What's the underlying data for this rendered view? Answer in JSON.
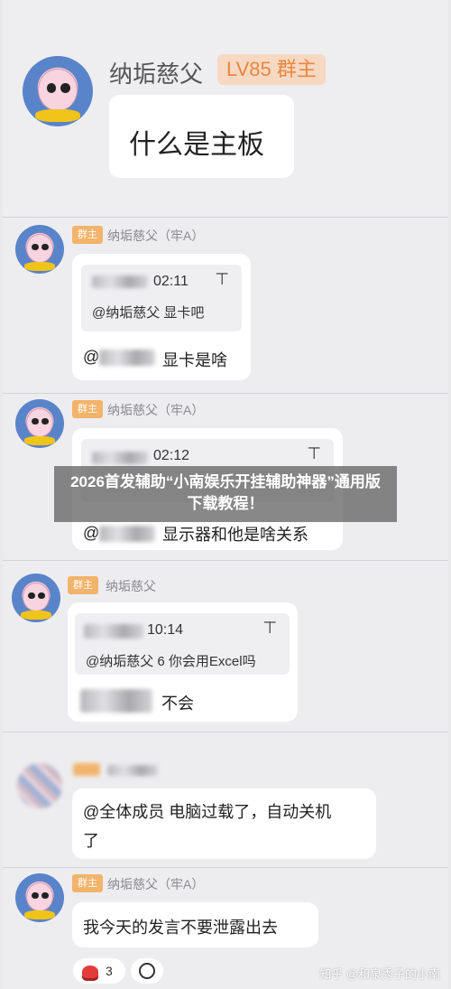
{
  "messages": [
    {
      "sender": "纳垢慈父",
      "badge": "LV85 群主",
      "text": "什么是主板"
    },
    {
      "sender": "纳垢慈父（牢A）",
      "badge": "群主",
      "quote_time": "02:11",
      "quote_text": "@纳垢慈父 显卡吧",
      "text": "显卡是啥"
    },
    {
      "sender": "纳垢慈父（牢A）",
      "badge": "群主",
      "quote_time": "02:12",
      "quote_text": "",
      "text": "显示器和他是啥关系"
    },
    {
      "sender": "纳垢慈父",
      "badge": "群主",
      "quote_time": "10:14",
      "quote_text": "@纳垢慈父 6 你会用Excel吗",
      "text": "不会"
    },
    {
      "text_line1": "@全体成员 电脑过载了，自动关机",
      "text_line2": "了"
    },
    {
      "sender": "纳垢慈父（牢A）",
      "badge": "群主",
      "text": "我今天的发言不要泄露出去",
      "reaction_count": "3"
    }
  ],
  "overlay": {
    "title": "2026首发辅助“小南娱乐开挂辅助神器”通用版下载教程！"
  },
  "watermark": "知乎 @和泉秀子的小南",
  "icons": {
    "pin": "⊤",
    "reaction": "red-button-emoji",
    "add_reaction": "emoji-add-icon"
  }
}
